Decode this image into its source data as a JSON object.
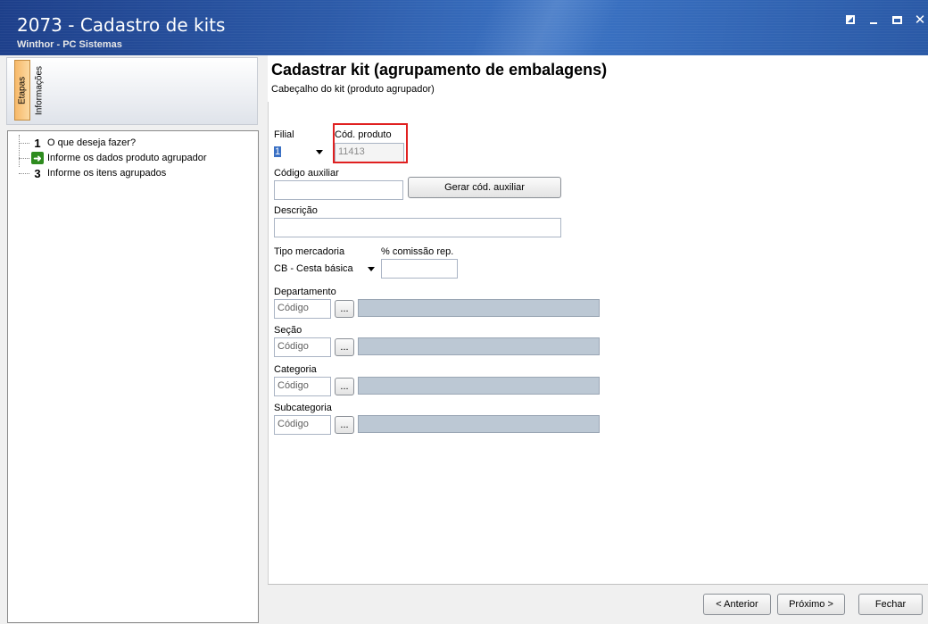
{
  "window": {
    "title": "2073 - Cadastro de kits",
    "subtitle": "Winthor - PC Sistemas"
  },
  "sidebar": {
    "tabs": [
      "Etapas",
      "Informações"
    ],
    "steps": [
      {
        "marker": "1",
        "label": "O que deseja fazer?"
      },
      {
        "marker": "arrow",
        "label": "Informe os dados produto agrupador"
      },
      {
        "marker": "3",
        "label": "Informe os itens agrupados"
      }
    ]
  },
  "main": {
    "title": "Cadastrar kit (agrupamento de embalagens)",
    "subtitle": "Cabeçalho do kit (produto agrupador)"
  },
  "form": {
    "filial_label": "Filial",
    "filial_value": "1",
    "cod_produto_label": "Cód. produto",
    "cod_produto_value": "11413",
    "codigo_auxiliar_label": "Código auxiliar",
    "codigo_auxiliar_value": "",
    "gerar_button": "Gerar cód. auxiliar",
    "descricao_label": "Descrição",
    "descricao_value": "",
    "tipo_mercadoria_label": "Tipo mercadoria",
    "tipo_mercadoria_value": "CB - Cesta básica",
    "comissao_label": "% comissão rep.",
    "comissao_value": "",
    "departamento_label": "Departamento",
    "secao_label": "Seção",
    "categoria_label": "Categoria",
    "subcategoria_label": "Subcategoria",
    "codigo_placeholder": "Código",
    "lookup_button": "..."
  },
  "footer": {
    "anterior": "< Anterior",
    "proximo": "Próximo >",
    "fechar": "Fechar"
  },
  "colors": {
    "title_bar": "#2c5aa8",
    "highlight": "#e02020",
    "step_arrow": "#2e8b1e"
  }
}
